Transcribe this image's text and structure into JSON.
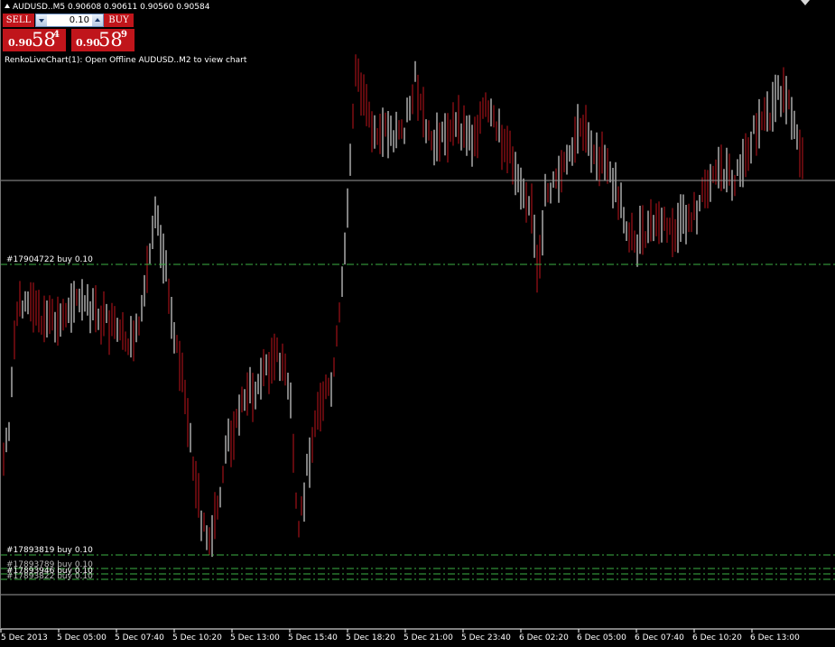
{
  "chart_header": {
    "symbol_line": "AUDUSD..M5  0.90608 0.90611 0.90560 0.90584"
  },
  "trade_panel": {
    "sell_label": "SELL",
    "buy_label": "BUY",
    "lot_value": "0.10",
    "sell_price": {
      "prefix": "0.90",
      "big": "58",
      "small": "4"
    },
    "buy_price": {
      "prefix": "0.90",
      "big": "58",
      "small": "9"
    }
  },
  "info_text": "RenkoLiveChart(1): Open Offline AUDUSD..M2 to view chart",
  "orders": [
    {
      "label": "#17904722 buy 0.10"
    },
    {
      "label": "#17893819 buy 0.10"
    },
    {
      "label": "#17893789 buy 0.10"
    },
    {
      "label": "#17893946 buy 0.10"
    },
    {
      "label": "#17893822 buy 0.10"
    }
  ],
  "time_axis": [
    "5 Dec 2013",
    "5 Dec 05:00",
    "5 Dec 07:40",
    "5 Dec 10:20",
    "5 Dec 13:00",
    "5 Dec 15:40",
    "5 Dec 18:20",
    "5 Dec 21:00",
    "5 Dec 23:40",
    "6 Dec 02:20",
    "6 Dec 05:00",
    "6 Dec 07:40",
    "6 Dec 10:20",
    "6 Dec 13:00"
  ],
  "colors": {
    "background": "#000000",
    "bull_bar": "#ffffff",
    "bear_bar": "#c0151b",
    "order_line": "#3cb043",
    "price_line": "#b0b0b0",
    "button": "#c0151b"
  }
}
